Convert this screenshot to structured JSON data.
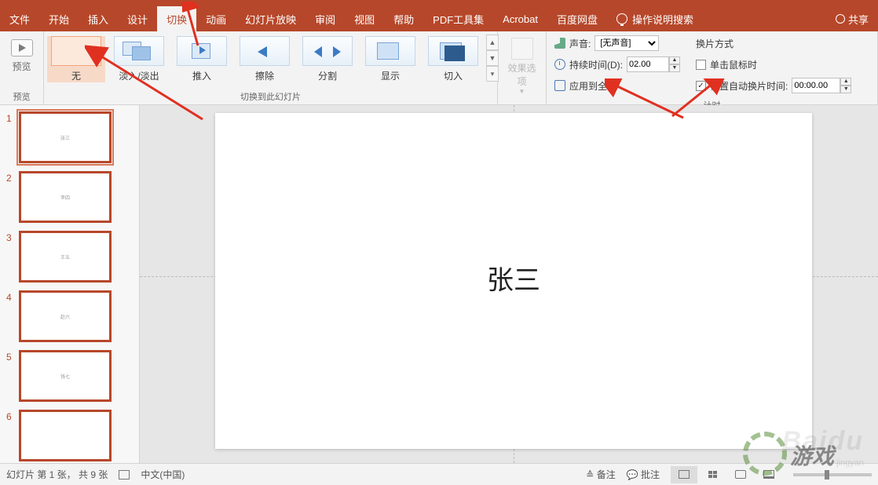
{
  "tabs": {
    "file": "文件",
    "home": "开始",
    "insert": "插入",
    "design": "设计",
    "transition": "切换",
    "animation": "动画",
    "slideshow": "幻灯片放映",
    "review": "审阅",
    "view": "视图",
    "help": "帮助",
    "pdf": "PDF工具集",
    "acrobat": "Acrobat",
    "baidu": "百度网盘",
    "tellme": "操作说明搜索",
    "share": "共享"
  },
  "ribbon": {
    "preview": {
      "label": "预览",
      "group": "预览"
    },
    "transitions": {
      "group": "切换到此幻灯片",
      "items": [
        "无",
        "淡入/淡出",
        "推入",
        "擦除",
        "分割",
        "显示",
        "切入"
      ]
    },
    "effect_options": "效果选项",
    "timing": {
      "group": "计时",
      "sound_label": "声音:",
      "sound_value": "[无声音]",
      "duration_label": "持续时间(D):",
      "duration_value": "02.00",
      "apply_all": "应用到全部",
      "advance_title": "换片方式",
      "on_click": "单击鼠标时",
      "on_click_checked": false,
      "after": "设置自动换片时间:",
      "after_checked": true,
      "after_value": "00:00.00"
    }
  },
  "thumbnails": [
    {
      "n": "1",
      "txt": "张三"
    },
    {
      "n": "2",
      "txt": "李四"
    },
    {
      "n": "3",
      "txt": "王五"
    },
    {
      "n": "4",
      "txt": "赵六"
    },
    {
      "n": "5",
      "txt": "钱七"
    },
    {
      "n": "6",
      "txt": ""
    }
  ],
  "slide": {
    "text": "张三"
  },
  "status": {
    "slide_info": "幻灯片 第 1 张， 共 9 张",
    "lang": "中文(中国)",
    "notes": "备注",
    "comments": "批注"
  },
  "watermark": {
    "main": "Baidu",
    "sub": "jingyan",
    "logo": "游戏"
  }
}
